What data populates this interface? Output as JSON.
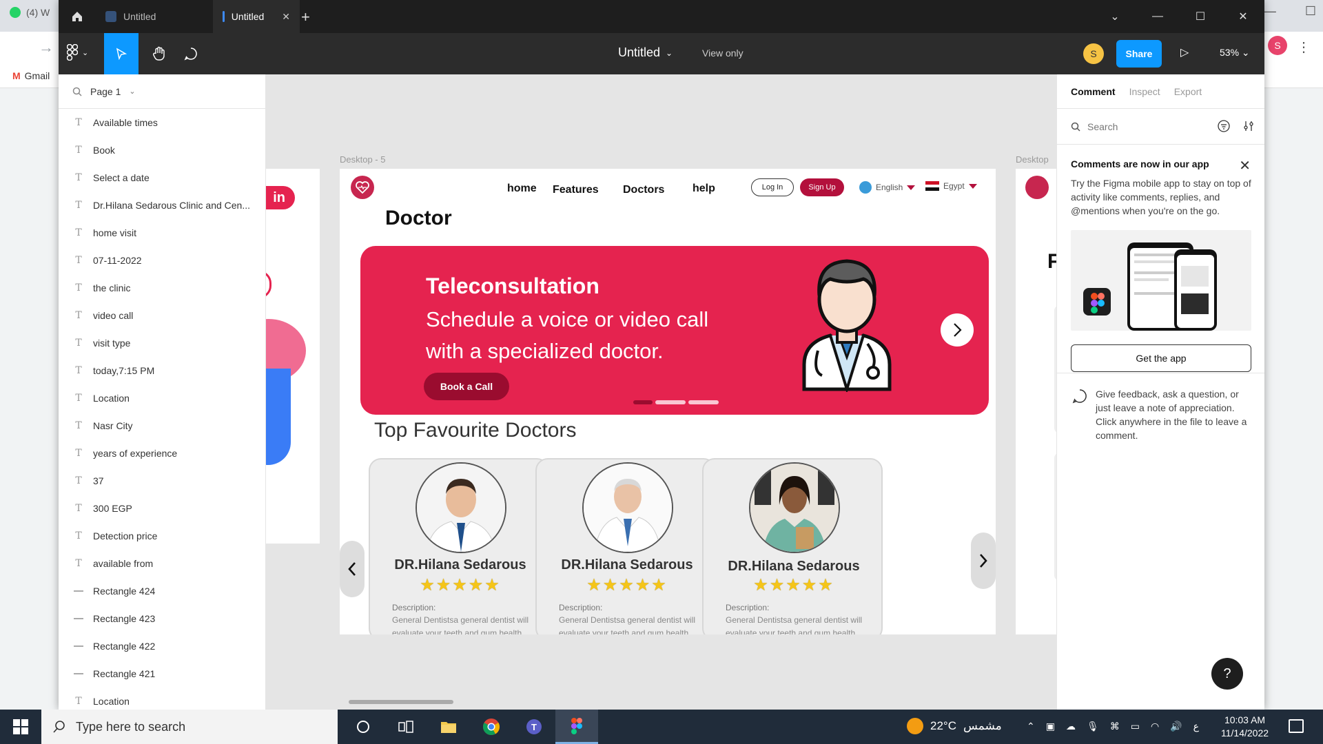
{
  "background_browser": {
    "tab_label": "(4) W",
    "bookmark": "Gmail",
    "avatar_letter": "S"
  },
  "figma": {
    "tabs": [
      {
        "label": "Untitled",
        "active": false
      },
      {
        "label": "Untitled",
        "active": true
      }
    ],
    "file_name": "Untitled",
    "view_mode": "View only",
    "user_initial": "S",
    "share_label": "Share",
    "zoom": "53%"
  },
  "layers": {
    "page": "Page 1",
    "items": [
      {
        "type": "text",
        "name": "Available times"
      },
      {
        "type": "text",
        "name": "Book"
      },
      {
        "type": "text",
        "name": "Select a date"
      },
      {
        "type": "text",
        "name": "Dr.Hilana Sedarous Clinic and Cen..."
      },
      {
        "type": "text",
        "name": "home visit"
      },
      {
        "type": "text",
        "name": "07-11-2022"
      },
      {
        "type": "text",
        "name": "the clinic"
      },
      {
        "type": "text",
        "name": "video call"
      },
      {
        "type": "text",
        "name": "visit type"
      },
      {
        "type": "text",
        "name": "today,7:15 PM"
      },
      {
        "type": "text",
        "name": "Location"
      },
      {
        "type": "text",
        "name": "Nasr City"
      },
      {
        "type": "text",
        "name": "years of experience"
      },
      {
        "type": "text",
        "name": "37"
      },
      {
        "type": "text",
        "name": "300 EGP"
      },
      {
        "type": "text",
        "name": "Detection price"
      },
      {
        "type": "text",
        "name": "available from"
      },
      {
        "type": "rect",
        "name": "Rectangle 424"
      },
      {
        "type": "rect",
        "name": "Rectangle 423"
      },
      {
        "type": "rect",
        "name": "Rectangle 422"
      },
      {
        "type": "rect",
        "name": "Rectangle 421"
      },
      {
        "type": "text",
        "name": "Location"
      }
    ]
  },
  "canvas": {
    "frame_label": "Desktop - 5",
    "frame_label_right": "Desktop",
    "left_frame_pill": "in",
    "right_frame_letter": "F"
  },
  "design": {
    "nav": [
      "home",
      "Features",
      "Doctors",
      "help"
    ],
    "login": "Log In",
    "signup": "Sign Up",
    "language": "English",
    "country": "Egypt",
    "page_title": "Doctor",
    "banner": {
      "title": "Teleconsultation",
      "subtitle": "Schedule a voice or video call with a specialized doctor.",
      "button": "Book a Call"
    },
    "section_title": "Top Favourite Doctors",
    "doctors": [
      {
        "name": "DR.Hilana Sedarous",
        "stars": "★★★★★",
        "desc_label": "Description:",
        "desc": "General Dentistsa general dentist will evaluate your teeth and gum health"
      },
      {
        "name": "DR.Hilana Sedarous",
        "stars": "★★★★★",
        "desc_label": "Description:",
        "desc": "General Dentistsa general dentist will evaluate your teeth and gum health"
      },
      {
        "name": "DR.Hilana Sedarous",
        "stars": "★★★★★",
        "desc_label": "Description:",
        "desc": "General Dentistsa general dentist will evaluate your teeth and gum health"
      }
    ],
    "colors": {
      "primary": "#e5234f",
      "dark_primary": "#9a0c2f",
      "star": "#f5c518"
    }
  },
  "comment_panel": {
    "tabs": [
      "Comment",
      "Inspect",
      "Export"
    ],
    "search_placeholder": "Search",
    "promo_title": "Comments are now in our app",
    "promo_text": "Try the Figma mobile app to stay on top of activity like comments, replies, and @mentions when you're on the go.",
    "get_app": "Get the app",
    "feedback": "Give feedback, ask a question, or just leave a note of appreciation. Click anywhere in the file to leave a comment.",
    "help": "?"
  },
  "taskbar": {
    "search_placeholder": "Type here to search",
    "temperature": "22°C",
    "weather": "مشمس",
    "ime": "ع",
    "time": "10:03 AM",
    "date": "11/14/2022"
  }
}
